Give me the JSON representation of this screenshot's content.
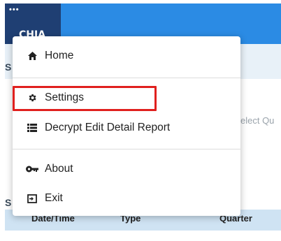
{
  "header": {
    "dots": "•••",
    "brand": "CHIA"
  },
  "background": {
    "letter_top": "S",
    "letter_bottom": "S",
    "select_hint": "elect Qu",
    "table_headers": [
      "Date/Time",
      "Type",
      "Quarter"
    ]
  },
  "menu": {
    "items": [
      {
        "label": "Home",
        "icon": "home-icon"
      },
      {
        "label": "Settings",
        "icon": "gear-icon"
      },
      {
        "label": "Decrypt Edit Detail Report",
        "icon": "list-icon"
      },
      {
        "label": "About",
        "icon": "key-icon"
      },
      {
        "label": "Exit",
        "icon": "exit-icon"
      }
    ]
  },
  "colors": {
    "header_dark": "#1f3f73",
    "header_blue": "#2b8be4",
    "highlight": "#e0201e"
  }
}
